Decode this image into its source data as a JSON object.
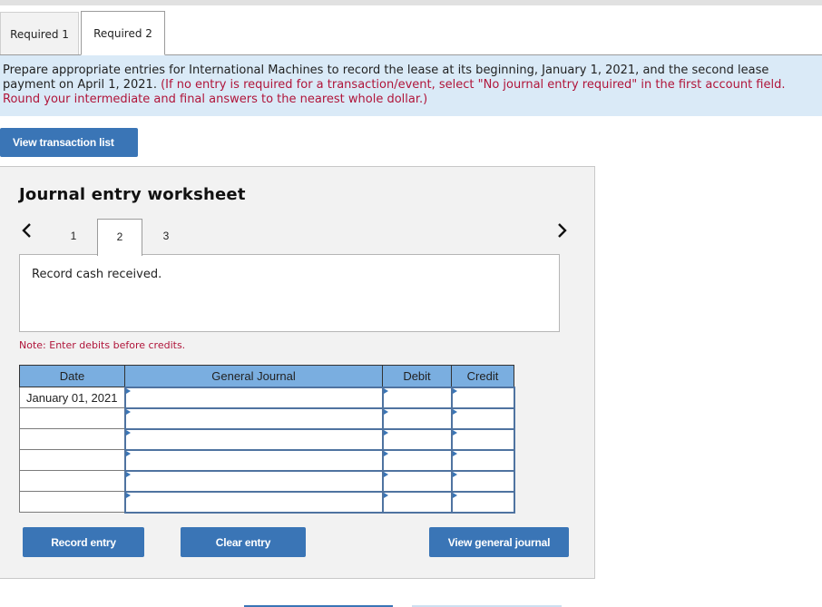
{
  "tabs": [
    {
      "label": "Required 1",
      "active": false
    },
    {
      "label": "Required 2",
      "active": true
    }
  ],
  "instructions": {
    "main": "Prepare appropriate entries for International Machines to record the lease at its beginning, January 1, 2021, and the second lease payment on April 1, 2021.",
    "note": "(If no entry is required for a transaction/event, select \"No journal entry required\" in the first account field. Round your intermediate and final answers to the nearest whole dollar.)"
  },
  "view_transaction_list_label": "View transaction list",
  "worksheet": {
    "title": "Journal entry worksheet",
    "pages": [
      "1",
      "2",
      "3"
    ],
    "current_page": "2",
    "description": "Record cash received.",
    "note": "Note: Enter debits before credits.",
    "columns": {
      "date": "Date",
      "account": "General Journal",
      "debit": "Debit",
      "credit": "Credit"
    },
    "rows": [
      {
        "date": "January 01, 2021",
        "account": "",
        "debit": "",
        "credit": ""
      },
      {
        "date": "",
        "account": "",
        "debit": "",
        "credit": ""
      },
      {
        "date": "",
        "account": "",
        "debit": "",
        "credit": ""
      },
      {
        "date": "",
        "account": "",
        "debit": "",
        "credit": ""
      },
      {
        "date": "",
        "account": "",
        "debit": "",
        "credit": ""
      },
      {
        "date": "",
        "account": "",
        "debit": "",
        "credit": ""
      }
    ],
    "buttons": {
      "record": "Record entry",
      "clear": "Clear entry",
      "view_journal": "View general journal"
    }
  },
  "icons": {
    "prev": "chevron-left-icon",
    "next": "chevron-right-icon"
  },
  "colors": {
    "accent": "#3a75b6",
    "header_blue": "#7aaee0",
    "instruction_bg": "#daeaf7",
    "note_red": "#b0153a"
  }
}
